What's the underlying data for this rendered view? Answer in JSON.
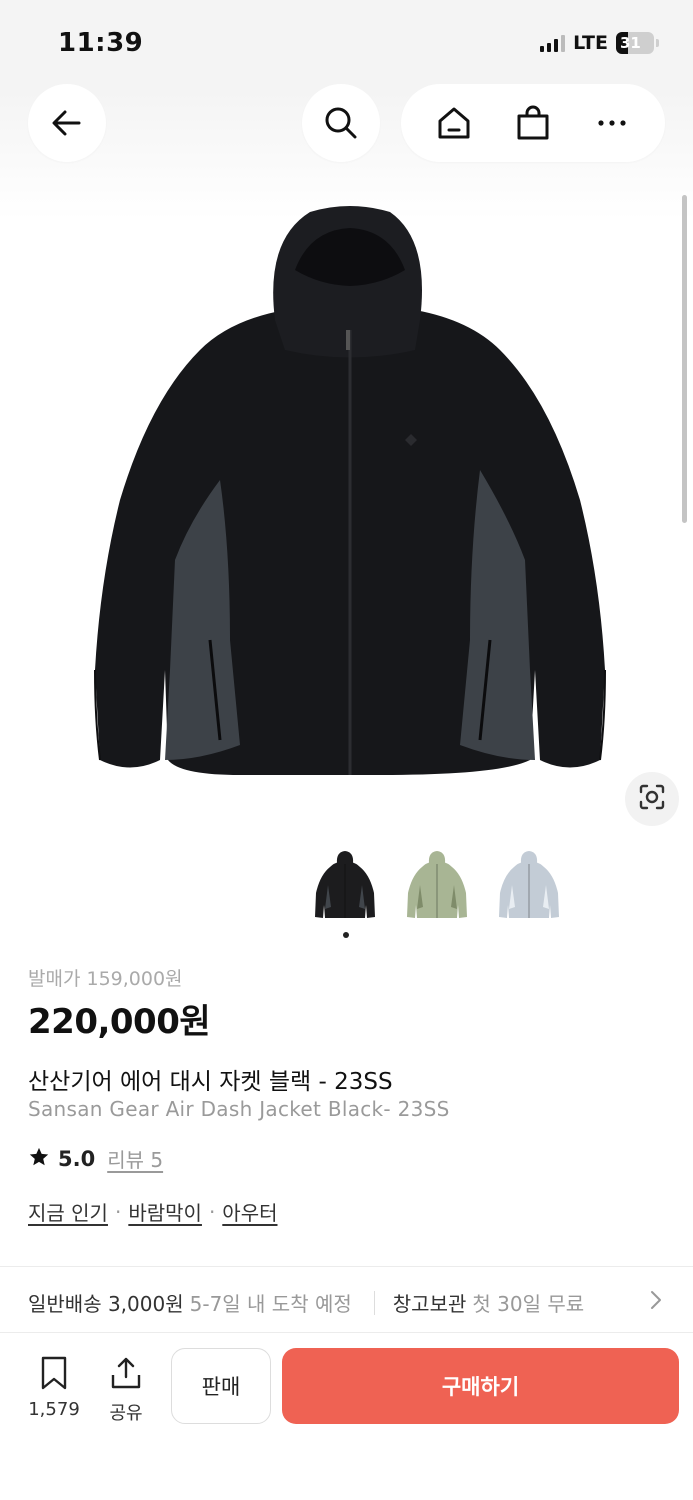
{
  "status_bar": {
    "time": "11:39",
    "network": "LTE",
    "battery": "31",
    "battery_level": 0.31
  },
  "nav": {
    "icons": [
      "back-arrow-icon",
      "search-icon",
      "home-icon",
      "shopping-bag-icon",
      "more-icon"
    ]
  },
  "product": {
    "release_price": "발매가 159,000원",
    "price": "220,000원",
    "title_ko": "산산기어 에어 대시 자켓 블랙 - 23SS",
    "title_en": "Sansan Gear Air Dash Jacket Black- 23SS",
    "rating": "5.0",
    "reviews": "리뷰 5",
    "tags": [
      "지금 인기",
      "바람막이",
      "아우터"
    ],
    "tag_separator": "·",
    "variants": [
      {
        "color": "#1c1c1e"
      },
      {
        "color": "#a8b594"
      },
      {
        "color": "#c3ccd6"
      }
    ],
    "selected_variant": 0
  },
  "shipping": {
    "general": "일반배송 3,000원",
    "eta": "5-7일 내 도착 예정",
    "storage": "창고보관",
    "storage_offer": "첫 30일 무료"
  },
  "bottom_bar": {
    "bookmark_count": "1,579",
    "share_label": "공유",
    "sell_label": "판매",
    "buy_label": "구매하기",
    "accent": "#ef6253"
  }
}
